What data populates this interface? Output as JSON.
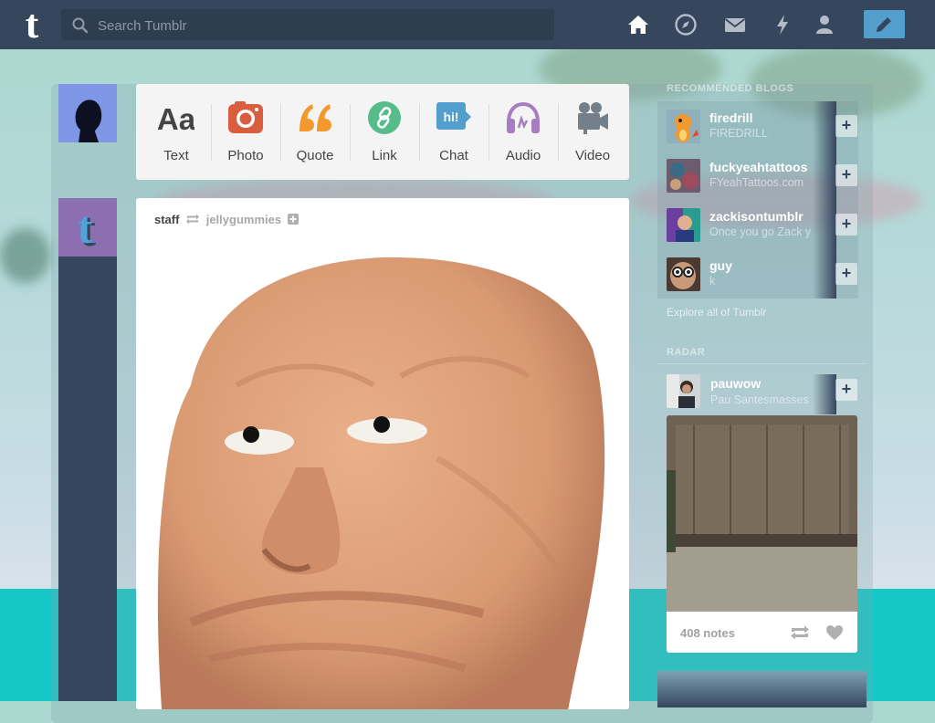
{
  "header": {
    "logo_text": "t",
    "search_placeholder": "Search Tumblr",
    "nav": [
      "home-icon",
      "explore-compass-icon",
      "messages-icon",
      "activity-lightning-icon",
      "account-icon"
    ],
    "compose_icon": "pencil-icon",
    "colors": {
      "bar": "#36465d",
      "search": "#2f3d51",
      "compose": "#529ecc"
    }
  },
  "post_types": [
    {
      "label": "Text",
      "icon": "text-aa-icon",
      "color": "#444444"
    },
    {
      "label": "Photo",
      "icon": "camera-icon",
      "color": "#d95e40"
    },
    {
      "label": "Quote",
      "icon": "quote-icon",
      "color": "#f2992e"
    },
    {
      "label": "Link",
      "icon": "link-icon",
      "color": "#56bc8a"
    },
    {
      "label": "Chat",
      "icon": "chat-icon",
      "color": "#529ecc",
      "chat_text": "hi!"
    },
    {
      "label": "Audio",
      "icon": "headphones-icon",
      "color": "#a77dc2"
    },
    {
      "label": "Video",
      "icon": "video-camera-icon",
      "color": "#748089"
    }
  ],
  "post": {
    "author": "staff",
    "reblogged_from": "jellygummies",
    "image_description": "clay-face-sculpture"
  },
  "sidebar": {
    "recommended_title": "RECOMMENDED BLOGS",
    "recommended": [
      {
        "name": "firedrill",
        "subtitle": "FIREDRILL"
      },
      {
        "name": "fuckyeahtattoos",
        "subtitle": "FYeahTattoos.com"
      },
      {
        "name": "zackisontumblr",
        "subtitle": "Once you go Zack y"
      },
      {
        "name": "guy",
        "subtitle": "k"
      }
    ],
    "follow_label": "+",
    "explore_link": "Explore all of Tumblr",
    "radar_title": "RADAR",
    "radar": {
      "name": "pauwow",
      "subtitle": "Pau Santesmasses",
      "notes": "408 notes"
    }
  }
}
